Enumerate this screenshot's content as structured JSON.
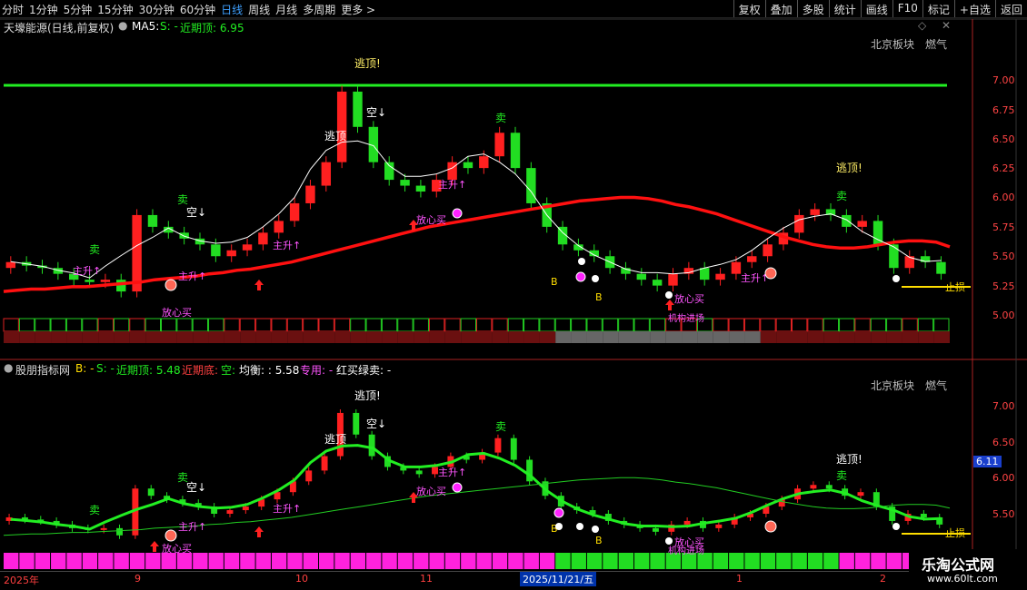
{
  "toolbar": {
    "periods": [
      "分时",
      "1分钟",
      "5分钟",
      "15分钟",
      "30分钟",
      "60分钟",
      "日线",
      "周线",
      "月线",
      "多周期",
      "更多 >"
    ],
    "active": "日线",
    "right_buttons": [
      "复权",
      "叠加",
      "多股",
      "统计",
      "画线",
      "F10",
      "标记",
      "+自选",
      "返回"
    ]
  },
  "top_panel": {
    "title": "天壕能源(日线,前复权)",
    "ma_label": "MA5:",
    "s_label": "S: -",
    "recent_top": "近期顶: 6.95",
    "right_tags": [
      "北京板块",
      "燃气"
    ],
    "yticks": [
      "7.00",
      "6.75",
      "6.50",
      "6.25",
      "6.00",
      "5.75",
      "5.50",
      "5.25",
      "5.00"
    ],
    "annotations": {
      "escape1": "逃顶!",
      "escape2": "逃顶",
      "escape3": "逃顶!",
      "sell": "卖",
      "empty": "空↓",
      "rise": "主升↑",
      "buy_calm": "放心买",
      "stop_loss": "止损",
      "b": "B",
      "institution": "机构进场"
    }
  },
  "bottom_panel": {
    "title": "股朋指标网",
    "b_label": "B: -",
    "s_label": "S: -",
    "recent_top": "近期顶: 5.48",
    "recent_bottom": "近期底:",
    "empty": "空:",
    "balance": "均衡: : 5.58",
    "special": "专用: -",
    "red_buy": "红买绿卖: -",
    "right_tags": [
      "北京板块",
      "燃气"
    ],
    "yticks": [
      "7.00",
      "6.50",
      "6.00",
      "5.50"
    ],
    "price_tag": "6.11"
  },
  "xaxis": {
    "ticks": [
      "2025年",
      "9",
      "10",
      "11",
      "1",
      "2"
    ],
    "selected_date": "2025/11/21/五"
  },
  "watermark": {
    "site": "乐淘公式网",
    "url": "www.60lt.com"
  },
  "colors": {
    "up": "#ff2020",
    "down": "#22dd22",
    "ma_red": "#ff1010",
    "ma_white": "#ffffff",
    "green_line": "#22ee22",
    "yellow": "#ffdd00",
    "magenta": "#ff22ff"
  },
  "chart_data": {
    "type": "candlestick",
    "ylim": [
      4.9,
      7.15
    ],
    "ma_red": [
      5.2,
      5.21,
      5.22,
      5.22,
      5.23,
      5.24,
      5.24,
      5.25,
      5.26,
      5.27,
      5.28,
      5.3,
      5.31,
      5.32,
      5.33,
      5.35,
      5.36,
      5.38,
      5.39,
      5.41,
      5.43,
      5.45,
      5.48,
      5.51,
      5.54,
      5.57,
      5.6,
      5.63,
      5.66,
      5.69,
      5.72,
      5.75,
      5.77,
      5.79,
      5.81,
      5.83,
      5.85,
      5.87,
      5.89,
      5.91,
      5.93,
      5.95,
      5.97,
      5.98,
      5.99,
      6.0,
      6.0,
      5.99,
      5.97,
      5.94,
      5.92,
      5.89,
      5.86,
      5.82,
      5.78,
      5.74,
      5.7,
      5.66,
      5.63,
      5.6,
      5.58,
      5.57,
      5.57,
      5.58,
      5.6,
      5.62,
      5.63,
      5.63,
      5.62,
      5.58
    ],
    "candles": [
      [
        5.4,
        5.45
      ],
      [
        5.45,
        5.42
      ],
      [
        5.42,
        5.4
      ],
      [
        5.4,
        5.35
      ],
      [
        5.35,
        5.3
      ],
      [
        5.3,
        5.28
      ],
      [
        5.28,
        5.3
      ],
      [
        5.3,
        5.2
      ],
      [
        5.2,
        5.85
      ],
      [
        5.85,
        5.75
      ],
      [
        5.75,
        5.7
      ],
      [
        5.7,
        5.65
      ],
      [
        5.65,
        5.6
      ],
      [
        5.6,
        5.5
      ],
      [
        5.5,
        5.55
      ],
      [
        5.55,
        5.6
      ],
      [
        5.6,
        5.7
      ],
      [
        5.7,
        5.8
      ],
      [
        5.8,
        5.95
      ],
      [
        5.95,
        6.1
      ],
      [
        6.1,
        6.3
      ],
      [
        6.3,
        6.9
      ],
      [
        6.9,
        6.6
      ],
      [
        6.6,
        6.3
      ],
      [
        6.3,
        6.15
      ],
      [
        6.15,
        6.1
      ],
      [
        6.1,
        6.05
      ],
      [
        6.05,
        6.15
      ],
      [
        6.15,
        6.3
      ],
      [
        6.3,
        6.25
      ],
      [
        6.25,
        6.35
      ],
      [
        6.35,
        6.55
      ],
      [
        6.55,
        6.25
      ],
      [
        6.25,
        5.95
      ],
      [
        5.95,
        5.75
      ],
      [
        5.75,
        5.6
      ],
      [
        5.6,
        5.55
      ],
      [
        5.55,
        5.5
      ],
      [
        5.5,
        5.4
      ],
      [
        5.4,
        5.35
      ],
      [
        5.35,
        5.3
      ],
      [
        5.3,
        5.25
      ],
      [
        5.25,
        5.35
      ],
      [
        5.35,
        5.4
      ],
      [
        5.4,
        5.3
      ],
      [
        5.3,
        5.35
      ],
      [
        5.35,
        5.45
      ],
      [
        5.45,
        5.5
      ],
      [
        5.5,
        5.6
      ],
      [
        5.6,
        5.7
      ],
      [
        5.7,
        5.85
      ],
      [
        5.85,
        5.9
      ],
      [
        5.9,
        5.85
      ],
      [
        5.85,
        5.75
      ],
      [
        5.75,
        5.8
      ],
      [
        5.8,
        5.6
      ],
      [
        5.6,
        5.4
      ],
      [
        5.4,
        5.5
      ],
      [
        5.5,
        5.45
      ],
      [
        5.45,
        5.35
      ]
    ]
  }
}
